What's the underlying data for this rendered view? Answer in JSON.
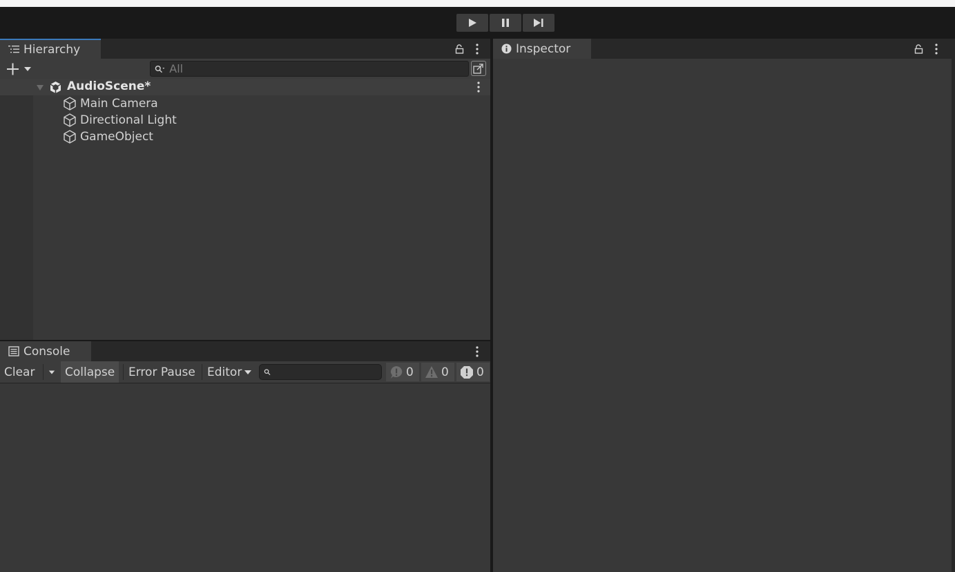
{
  "toolbar": {
    "play_icon": "play-icon",
    "pause_icon": "pause-icon",
    "step_icon": "step-icon"
  },
  "hierarchy": {
    "tab_label": "Hierarchy",
    "search_placeholder": "All",
    "scene_name": "AudioScene*",
    "items": [
      "Main Camera",
      "Directional Light",
      "GameObject"
    ]
  },
  "console": {
    "tab_label": "Console",
    "clear_label": "Clear",
    "collapse_label": "Collapse",
    "error_pause_label": "Error Pause",
    "editor_label": "Editor",
    "search_placeholder": "",
    "info_count": "0",
    "warning_count": "0",
    "error_count": "0"
  },
  "inspector": {
    "tab_label": "Inspector"
  },
  "colors": {
    "accent": "#3a79bb",
    "panel_bg": "#383838",
    "toolbar_bg": "#191919"
  }
}
